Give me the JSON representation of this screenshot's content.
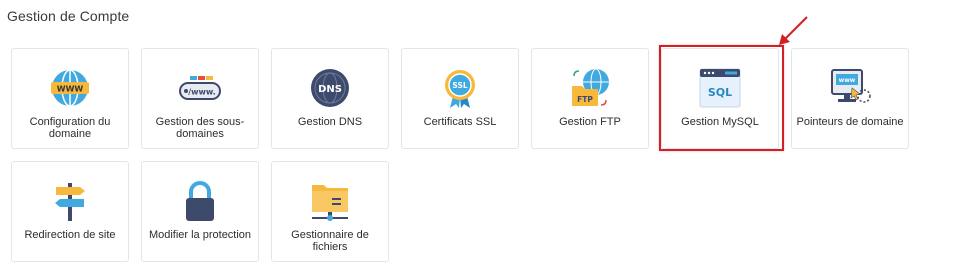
{
  "section": {
    "title": "Gestion de Compte"
  },
  "tiles": [
    {
      "label": "Configuration du domaine",
      "icon": "www-globe-icon"
    },
    {
      "label": "Gestion des sous-domaines",
      "icon": "subdomain-www-icon"
    },
    {
      "label": "Gestion DNS",
      "icon": "dns-globe-icon"
    },
    {
      "label": "Certificats SSL",
      "icon": "ssl-badge-icon"
    },
    {
      "label": "Gestion FTP",
      "icon": "ftp-folder-icon"
    },
    {
      "label": "Gestion MySQL",
      "icon": "sql-window-icon"
    },
    {
      "label": "Pointeurs de domaine",
      "icon": "domain-pointer-monitor-icon"
    },
    {
      "label": "Redirection de site",
      "icon": "signpost-icon"
    },
    {
      "label": "Modifier la protection",
      "icon": "padlock-icon"
    },
    {
      "label": "Gestionnaire de fichiers",
      "icon": "file-manager-folder-icon"
    }
  ],
  "annotation": {
    "highlight_color": "#d32027",
    "highlighted_tile": "Gestion MySQL"
  }
}
